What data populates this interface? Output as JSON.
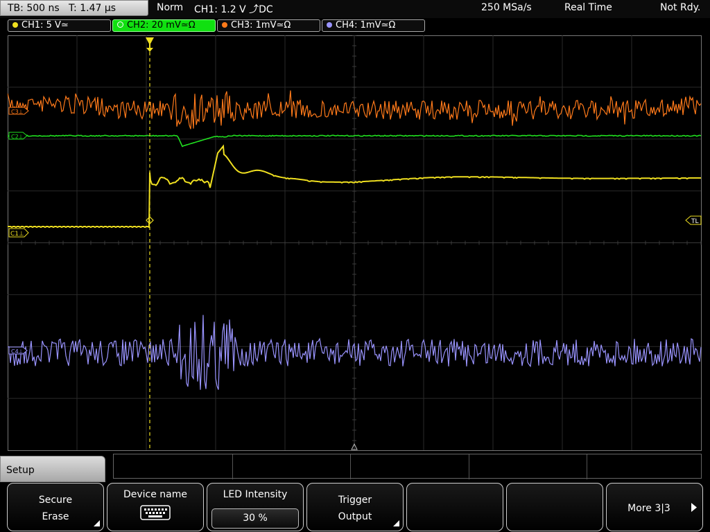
{
  "status": {
    "timebase": "TB: 500 ns",
    "trigger_time": "T: 1.47 µs",
    "acq_mode": "Norm",
    "trigger_info": "CH1: 1.2 V ⤴DC",
    "sample_rate": "250 MSa/s",
    "acq_type": "Real Time",
    "state": "Not Rdy."
  },
  "channels": [
    {
      "label": "CH1: 5 V≃",
      "color": "#f0e020",
      "active": false
    },
    {
      "label": "CH2: 20 mV≃Ω",
      "color": "#20e020",
      "active": true
    },
    {
      "label": "CH3: 1mV≃Ω",
      "color": "#ff7a1a",
      "active": false
    },
    {
      "label": "CH4: 1mV≃Ω",
      "color": "#9a94ff",
      "active": false
    }
  ],
  "markers": {
    "ch1": "C1⊥",
    "ch2": "C2⊥",
    "ch3": "C3⊥",
    "ch4": "C4⊥",
    "trigger_level": "TL"
  },
  "menu": {
    "title": "Setup",
    "softkeys": {
      "secure_line1": "Secure",
      "secure_line2": "Erase",
      "device_name": "Device name",
      "led_label": "LED Intensity",
      "led_value": "30 %",
      "trigger_line1": "Trigger",
      "trigger_line2": "Output",
      "more": "More 3|3"
    }
  },
  "icons": {
    "keyboard": "keyboard-icon",
    "more": "play-arrow-icon",
    "submenu": "corner-triangle-icon"
  }
}
